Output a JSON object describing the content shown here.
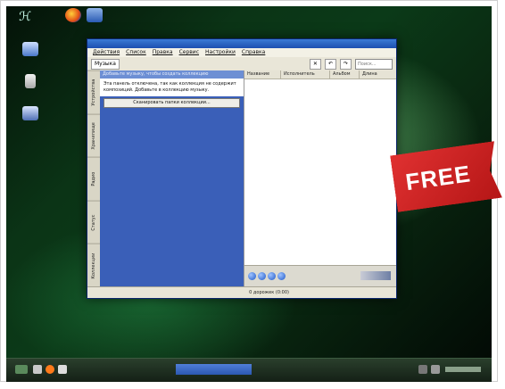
{
  "badge": {
    "text": "FREE",
    "color": "#d62727"
  },
  "desktop": {
    "top_icons": [
      {
        "icon": "firefox-icon",
        "label": ""
      },
      {
        "icon": "computer-icon",
        "label": ""
      }
    ],
    "side_icons": [
      {
        "icon": "home-folder-icon",
        "label": ""
      },
      {
        "icon": "trash-icon",
        "label": ""
      },
      {
        "icon": "printer-icon",
        "label": ""
      }
    ]
  },
  "window": {
    "menu": [
      "Действия",
      "Список",
      "Правка",
      "Сервис",
      "Настройки",
      "Справка"
    ],
    "toolbar": {
      "tab_label": "Музыка",
      "search_placeholder": "Поиск..."
    },
    "left_tabs": [
      "Устройства",
      "Хранилище",
      "Радио",
      "Статус",
      "Коллекции"
    ],
    "panel_header": "Добавьте музыку, чтобы создать коллекцию",
    "panel_message": "Эта панель отключена, так как коллекция не содержит композиций. Добавьте в коллекцию музыку.",
    "panel_button": "Сканировать папки коллекции...",
    "columns": [
      "Название",
      "Исполнитель",
      "Альбом",
      "Длина"
    ],
    "status_text": "0 дорожек (0:00)"
  }
}
